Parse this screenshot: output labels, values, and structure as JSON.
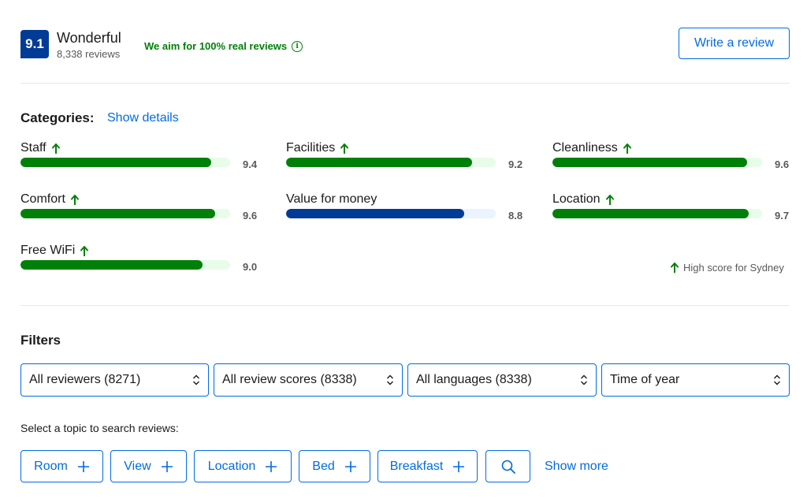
{
  "header": {
    "score": "9.1",
    "rating_word": "Wonderful",
    "review_count": "8,338 reviews",
    "real_reviews": "We aim for 100% real reviews",
    "info_icon": "info-icon",
    "write_review": "Write a review"
  },
  "categories": {
    "heading": "Categories:",
    "show_details": "Show details",
    "high_score_note": "High score for Sydney",
    "colors": {
      "green": "#008009",
      "green_track": "#e7fde9",
      "blue": "#003b95",
      "blue_track": "#ebf3ff"
    },
    "items": [
      {
        "label": "Staff",
        "score": "9.4",
        "value": 9.4,
        "high": true,
        "color": "green"
      },
      {
        "label": "Facilities",
        "score": "9.2",
        "value": 9.2,
        "high": true,
        "color": "green"
      },
      {
        "label": "Cleanliness",
        "score": "9.6",
        "value": 9.6,
        "high": true,
        "color": "green"
      },
      {
        "label": "Comfort",
        "score": "9.6",
        "value": 9.6,
        "high": true,
        "color": "green"
      },
      {
        "label": "Value for money",
        "score": "8.8",
        "value": 8.8,
        "high": false,
        "color": "blue"
      },
      {
        "label": "Location",
        "score": "9.7",
        "value": 9.7,
        "high": true,
        "color": "green"
      },
      {
        "label": "Free WiFi",
        "score": "9.0",
        "value": 9.0,
        "high": true,
        "color": "green"
      }
    ]
  },
  "filters": {
    "heading": "Filters",
    "selects": [
      {
        "value": "All reviewers (8271)"
      },
      {
        "value": "All review scores (8338)"
      },
      {
        "value": "All languages (8338)"
      },
      {
        "value": "Time of year"
      }
    ]
  },
  "topics": {
    "prompt": "Select a topic to search reviews:",
    "buttons": [
      "Room",
      "View",
      "Location",
      "Bed",
      "Breakfast"
    ],
    "search_icon": "search-icon",
    "show_more": "Show more"
  }
}
